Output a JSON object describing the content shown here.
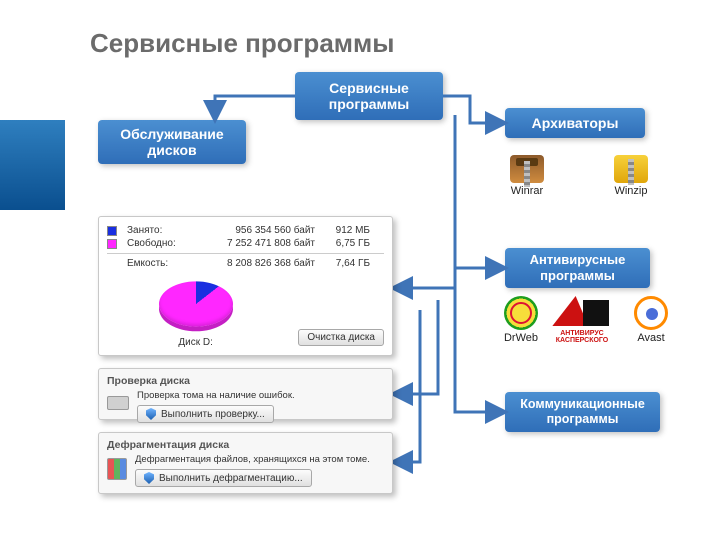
{
  "title": "Сервисные программы",
  "boxes": {
    "service": "Сервисные программы",
    "left1": "Обслуживание дисков",
    "arch": "Архиваторы",
    "av": "Антивирусные программы",
    "comm": "Коммуникационные программы"
  },
  "disk_panel": {
    "rows": [
      {
        "swatch": "used",
        "label": "Занято:",
        "bytes": "956 354 560 байт",
        "human": "912 МБ"
      },
      {
        "swatch": "free",
        "label": "Свободно:",
        "bytes": "7 252 471 808 байт",
        "human": "6,75 ГБ"
      }
    ],
    "total": {
      "label": "Емкость:",
      "bytes": "8 208 826 368 байт",
      "human": "7,64 ГБ"
    },
    "drive_label": "Диск D:",
    "button": "Очистка диска"
  },
  "check_panel": {
    "header": "Проверка диска",
    "text": "Проверка тома на наличие ошибок.",
    "button": "Выполнить проверку..."
  },
  "defrag_panel": {
    "header": "Дефрагментация диска",
    "text": "Дефрагментация файлов, хранящихся на этом томе.",
    "button": "Выполнить дефрагментацию..."
  },
  "apps": {
    "winrar": "Winrar",
    "winzip": "Winzip",
    "drweb": "DrWeb",
    "kaspersky_line1": "АНТИВИРУС",
    "kaspersky_line2": "КАСПЕРСКОГО",
    "avast": "Avast"
  },
  "chart_data": {
    "type": "pie",
    "title": "Диск D:",
    "series": [
      {
        "name": "Занято",
        "value_bytes": 956354560,
        "value_label": "912 МБ",
        "color": "#1a2fe0"
      },
      {
        "name": "Свободно",
        "value_bytes": 7252471808,
        "value_label": "6,75 ГБ",
        "color": "#ff27ff"
      }
    ],
    "total_bytes": 8208826368,
    "total_label": "7,64 ГБ"
  }
}
